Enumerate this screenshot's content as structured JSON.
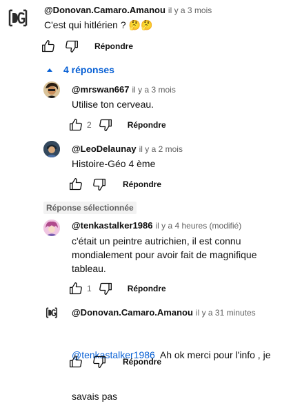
{
  "top_comment": {
    "author": "@Donovan.Camaro.Amanou",
    "time": "il y a 3 mois",
    "text": "C'est qui  hitlérien  ? 🤔🤔",
    "reply_label": "Répondre"
  },
  "replies_toggle": {
    "label": "4 réponses",
    "icon": "chevron-up-icon"
  },
  "replies": [
    {
      "author": "@mrswan667",
      "time": "il y a 3 mois",
      "text": "Utilise ton cerveau.",
      "likes": "2",
      "reply_label": "Répondre"
    },
    {
      "author": "@LeoDelaunay",
      "time": "il y a 2 mois",
      "text": "Histoire-Géo 4 ème",
      "likes": "",
      "reply_label": "Répondre"
    }
  ],
  "selected_label": "Réponse sélectionnée",
  "selected_reply": {
    "author": "@tenkastalker1986",
    "time": "il y a 4 heures (modifié)",
    "text_lines": [
      "c'était un peintre autrichien, il est connu",
      "mondialement pour avoir fait de magnifique",
      "tableau."
    ],
    "likes": "1",
    "reply_label": "Répondre"
  },
  "last_reply": {
    "author": "@Donovan.Camaro.Amanou",
    "time": "il y a 31 minutes",
    "mention": "@tenkastalker1986",
    "text_line1": "  Ah ok merci pour l'info , je",
    "text_line2": "savais pas",
    "reply_label": "Répondre"
  },
  "colors": {
    "link": "#065fd4",
    "secondary_text": "#606060",
    "primary_text": "#0f0f0f"
  }
}
